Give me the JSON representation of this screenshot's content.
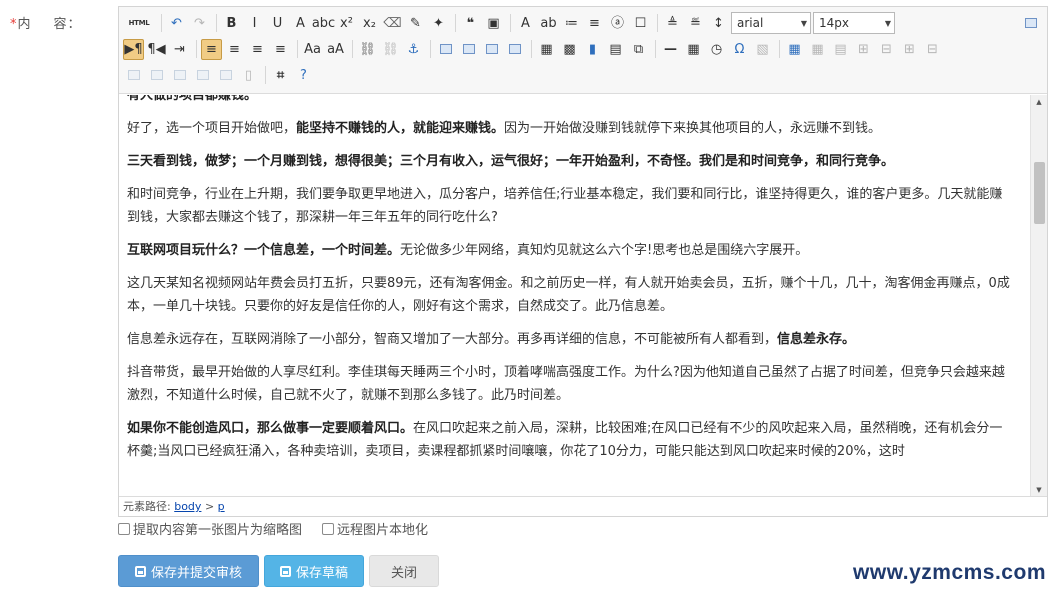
{
  "field": {
    "required_mark": "*",
    "label_a": "内",
    "label_b": "容："
  },
  "toolbar": {
    "source_label": "HTML",
    "font_family": "arial",
    "font_size": "14px",
    "row1": [
      {
        "name": "undo-icon",
        "glyph": "↶",
        "cls": "blue"
      },
      {
        "name": "redo-icon",
        "glyph": "↷",
        "cls": "dim"
      },
      {
        "name": "bold-button",
        "glyph": "B",
        "cls": "bold"
      },
      {
        "name": "italic-button",
        "glyph": "I",
        "cls": ""
      },
      {
        "name": "underline-button",
        "glyph": "U",
        "cls": ""
      },
      {
        "name": "font-border-button",
        "glyph": "A",
        "cls": ""
      },
      {
        "name": "strikethrough-button",
        "glyph": "abc",
        "cls": ""
      },
      {
        "name": "superscript-button",
        "glyph": "x²",
        "cls": ""
      },
      {
        "name": "subscript-button",
        "glyph": "x₂",
        "cls": ""
      },
      {
        "name": "eraser-icon",
        "glyph": "⌫",
        "cls": "grey"
      },
      {
        "name": "format-brush-icon",
        "glyph": "✎",
        "cls": ""
      },
      {
        "name": "auto-format-icon",
        "glyph": "✦",
        "cls": ""
      },
      {
        "name": "blockquote-icon",
        "glyph": "❝",
        "cls": "bold"
      },
      {
        "name": "paste-plain-icon",
        "glyph": "▣",
        "cls": ""
      }
    ],
    "row1b": [
      {
        "name": "font-color-button",
        "glyph": "A",
        "cls": ""
      },
      {
        "name": "background-color-button",
        "glyph": "ab",
        "cls": ""
      },
      {
        "name": "ordered-list-button",
        "glyph": "≔",
        "cls": ""
      },
      {
        "name": "unordered-list-button",
        "glyph": "≡",
        "cls": ""
      },
      {
        "name": "select-all-icon",
        "glyph": "ⓐ",
        "cls": ""
      },
      {
        "name": "clear-doc-icon",
        "glyph": "☐",
        "cls": ""
      }
    ],
    "row1c": [
      {
        "name": "row-spacing-top-button",
        "glyph": "≜",
        "cls": ""
      },
      {
        "name": "row-spacing-bottom-button",
        "glyph": "≝",
        "cls": ""
      },
      {
        "name": "line-height-button",
        "glyph": "↕",
        "cls": ""
      }
    ],
    "row2": [
      {
        "name": "direction-ltr-button",
        "glyph": "▶¶",
        "cls": "active"
      },
      {
        "name": "direction-rtl-button",
        "glyph": "¶◀",
        "cls": ""
      },
      {
        "name": "indent-button",
        "glyph": "⇥",
        "cls": ""
      },
      {
        "name": "align-left-button",
        "glyph": "≡",
        "cls": "active"
      },
      {
        "name": "align-center-button",
        "glyph": "≡",
        "cls": ""
      },
      {
        "name": "align-right-button",
        "glyph": "≡",
        "cls": ""
      },
      {
        "name": "align-justify-button",
        "glyph": "≡",
        "cls": ""
      },
      {
        "name": "to-uppercase-button",
        "glyph": "Aa",
        "cls": ""
      },
      {
        "name": "to-lowercase-button",
        "glyph": "aA",
        "cls": ""
      },
      {
        "name": "link-icon",
        "glyph": "⛓",
        "cls": "grey"
      },
      {
        "name": "unlink-icon",
        "glyph": "⛓",
        "cls": "dim"
      },
      {
        "name": "anchor-icon",
        "glyph": "⚓",
        "cls": "blue"
      },
      {
        "name": "image-none-icon",
        "glyph": "sq",
        "cls": ""
      },
      {
        "name": "image-left-icon",
        "glyph": "sq",
        "cls": ""
      },
      {
        "name": "image-right-icon",
        "glyph": "sq",
        "cls": ""
      },
      {
        "name": "image-center-icon",
        "glyph": "sq",
        "cls": ""
      },
      {
        "name": "simple-upload-icon",
        "glyph": "▦",
        "cls": ""
      },
      {
        "name": "insert-image-icon",
        "glyph": "▩",
        "cls": ""
      },
      {
        "name": "insert-video-icon",
        "glyph": "▮",
        "cls": "blue"
      },
      {
        "name": "attachment-icon",
        "glyph": "▤",
        "cls": ""
      },
      {
        "name": "insert-frame-icon",
        "glyph": "⧉",
        "cls": ""
      },
      {
        "name": "horizontal-rule-icon",
        "glyph": "—",
        "cls": "bold"
      },
      {
        "name": "insert-date-icon",
        "glyph": "▦",
        "cls": ""
      },
      {
        "name": "insert-time-icon",
        "glyph": "◷",
        "cls": ""
      },
      {
        "name": "special-chars-icon",
        "glyph": "Ω",
        "cls": "blue"
      },
      {
        "name": "snapscreen-icon",
        "glyph": "▧",
        "cls": "dim"
      },
      {
        "name": "insert-table-icon",
        "glyph": "▦",
        "cls": "blue"
      },
      {
        "name": "delete-table-icon",
        "glyph": "▦",
        "cls": "dim"
      },
      {
        "name": "insert-paragraph-before-table-icon",
        "glyph": "▤",
        "cls": "dim"
      },
      {
        "name": "insert-row-icon",
        "glyph": "⊞",
        "cls": "dim"
      },
      {
        "name": "delete-row-icon",
        "glyph": "⊟",
        "cls": "dim"
      },
      {
        "name": "insert-col-icon",
        "glyph": "⊞",
        "cls": "dim"
      },
      {
        "name": "delete-col-icon",
        "glyph": "⊟",
        "cls": "dim"
      }
    ],
    "row3": [
      {
        "name": "merge-cells-icon",
        "glyph": "sq",
        "cls": "dim"
      },
      {
        "name": "merge-right-icon",
        "glyph": "sq",
        "cls": "dim"
      },
      {
        "name": "merge-down-icon",
        "glyph": "sq",
        "cls": "dim"
      },
      {
        "name": "split-to-cells-icon",
        "glyph": "sq",
        "cls": "dim"
      },
      {
        "name": "split-to-rows-icon",
        "glyph": "sq",
        "cls": "dim"
      },
      {
        "name": "split-to-cols-icon",
        "glyph": "▯",
        "cls": "dim"
      },
      {
        "name": "search-replace-icon",
        "glyph": "⌗",
        "cls": "bold"
      },
      {
        "name": "help-icon",
        "glyph": "?",
        "cls": "blue"
      }
    ]
  },
  "content": {
    "paragraphs": [
      {
        "cls": "first",
        "runs": [
          {
            "b": true,
            "t": "有人做的项目都赚钱。"
          }
        ]
      },
      {
        "cls": "",
        "runs": [
          {
            "b": false,
            "t": "好了，选一个项目开始做吧，"
          },
          {
            "b": true,
            "t": "能坚持不赚钱的人，就能迎来赚钱。"
          },
          {
            "b": false,
            "t": "因为一开始做没赚到钱就停下来换其他项目的人，永远赚不到钱。"
          }
        ]
      },
      {
        "cls": "",
        "runs": [
          {
            "b": true,
            "t": "三天看到钱，做梦；一个月赚到钱，想得很美；三个月有收入，运气很好；一年开始盈利，不奇怪。我们是和时间竞争，和同行竞争。"
          }
        ]
      },
      {
        "cls": "",
        "runs": [
          {
            "b": false,
            "t": "和时间竞争，行业在上升期，我们要争取更早地进入，瓜分客户，培养信任;行业基本稳定，我们要和同行比，谁坚持得更久，谁的客户更多。几天就能赚到钱，大家都去赚这个钱了，那深耕一年三年五年的同行吃什么?"
          }
        ]
      },
      {
        "cls": "",
        "runs": [
          {
            "b": true,
            "t": "互联网项目玩什么？一个信息差，一个时间差。"
          },
          {
            "b": false,
            "t": "无论做多少年网络，真知灼见就这么六个字!思考也总是围绕六字展开。"
          }
        ]
      },
      {
        "cls": "",
        "runs": [
          {
            "b": false,
            "t": "这几天某知名视频网站年费会员打五折，只要89元，还有淘客佣金。和之前历史一样，有人就开始卖会员，五折，赚个十几，几十，淘客佣金再赚点，0成本，一单几十块钱。只要你的好友是信任你的人，刚好有这个需求，自然成交了。此乃信息差。"
          }
        ]
      },
      {
        "cls": "",
        "runs": [
          {
            "b": false,
            "t": "信息差永远存在，互联网消除了一小部分，智商又增加了一大部分。再多再详细的信息，不可能被所有人都看到，"
          },
          {
            "b": true,
            "t": "信息差永存。"
          }
        ]
      },
      {
        "cls": "",
        "runs": [
          {
            "b": false,
            "t": "抖音带货，最早开始做的人享尽红利。李佳琪每天睡两三个小时，顶着哮喘高强度工作。为什么?因为他知道自己虽然了占据了时间差，但竞争只会越来越激烈，不知道什么时候，自己就不火了，就赚不到那么多钱了。此乃时间差。"
          }
        ]
      },
      {
        "cls": "",
        "runs": [
          {
            "b": true,
            "t": "如果你不能创造风口，那么做事一定要顺着风口。"
          },
          {
            "b": false,
            "t": "在风口吹起来之前入局，深耕，比较困难;在风口已经有不少的风吹起来入局，虽然稍晚，还有机会分一杯羹;当风口已经疯狂涌入，各种卖培训，卖项目，卖课程都抓紧时间嚷嚷，你花了10分力，可能只能达到风口吹起来时候的20%，这时"
          }
        ]
      }
    ]
  },
  "elementpath": {
    "label": "元素路径:",
    "items": [
      "body",
      "p"
    ],
    "sep": ">"
  },
  "options": [
    {
      "label": "提取内容第一张图片为缩略图",
      "checked": false
    },
    {
      "label": "远程图片本地化",
      "checked": false
    }
  ],
  "buttons": {
    "submit_review": "保存并提交审核",
    "save_draft": "保存草稿",
    "close": "关闭"
  },
  "watermark": "www.yzmcms.com"
}
